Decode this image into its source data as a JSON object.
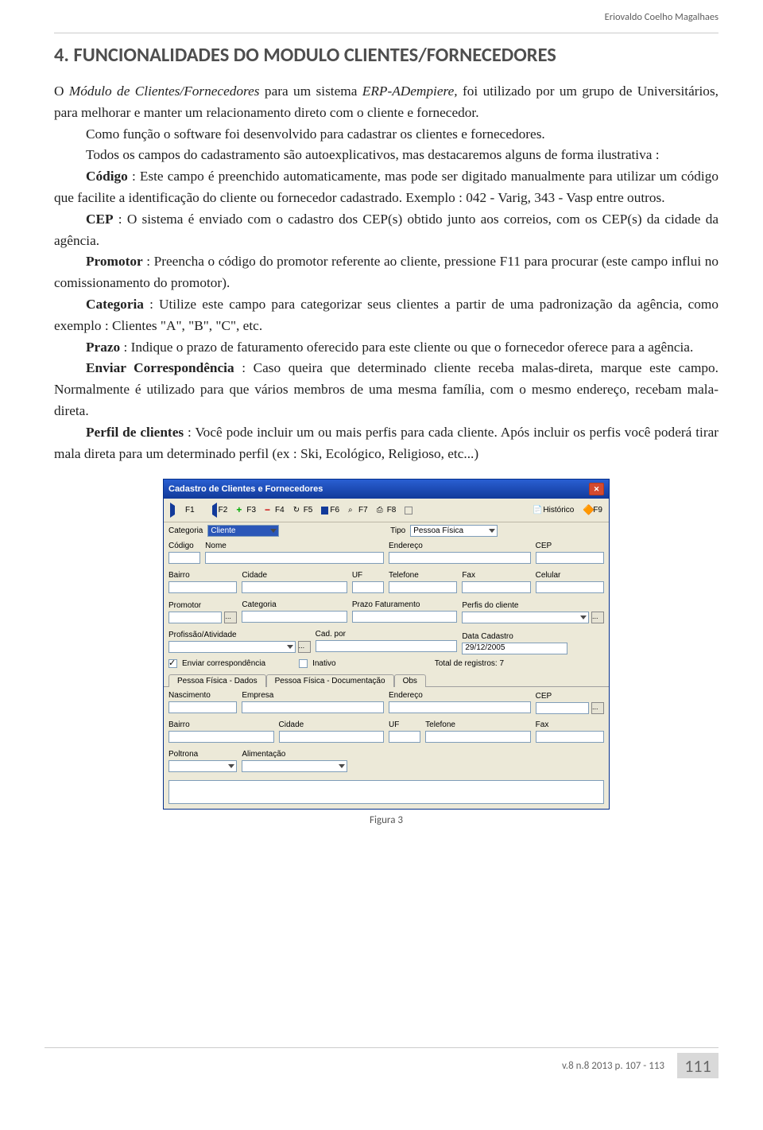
{
  "header_author": "Eriovaldo Coelho Magalhaes",
  "title": "4.   FUNCIONALIDADES DO MODULO CLIENTES/FORNECEDORES",
  "body": {
    "p1a": "O ",
    "p1b": "Módulo de Clientes/Fornecedores",
    "p1c": " para um sistema  ",
    "p1d": "ERP-ADempiere,",
    "p1e": " foi utilizado por um grupo de Universitários, para melhorar e manter um relacionamento direto com o cliente e fornecedor.",
    "p2": "Como função o software foi desenvolvido para cadastrar os clientes e fornecedores.",
    "p3": "Todos os campos do cadastramento são autoexplicativos, mas destacaremos alguns de forma ilustrativa :",
    "p4a": "Código",
    "p4b": " : Este campo é preenchido automaticamente, mas pode ser digitado manualmente para utilizar um código que facilite a identificação do cliente ou fornecedor cadastrado. Exemplo : 042 - Varig, 343 - Vasp entre outros.",
    "p5a": "CEP",
    "p5b": " : O sistema é enviado com o cadastro dos CEP(s) obtido junto aos correios, com os CEP(s) da cidade da agência.",
    "p6a": "Promotor",
    "p6b": " : Preencha o código do promotor referente ao cliente, pressione F11 para procurar (este campo influi no comissionamento do promotor).",
    "p7a": "Categoria",
    "p7b": " : Utilize este campo para categorizar seus clientes a partir de uma padronização da agência, como exemplo : Clientes \"A\", \"B\", \"C\", etc.",
    "p8a": "Prazo",
    "p8b": " : Indique o prazo de faturamento oferecido para este cliente ou que o fornecedor oferece para a agência.",
    "p9a": "Enviar Correspondência",
    "p9b": " : Caso  queira que determinado cliente receba malas-direta, marque este campo. Normalmente é utilizado para que vários membros de uma mesma família, com o mesmo endereço, recebam mala-direta.",
    "p10a": "Perfil de clientes",
    "p10b": " : Você pode incluir um ou mais perfis para cada cliente. Após incluir os perfis você poderá tirar mala direta para um determinado perfil (ex : Ski, Ecológico, Religioso, etc...)"
  },
  "figure_caption": "Figura 3",
  "form": {
    "title": "Cadastro de Clientes e Fornecedores",
    "toolbar": {
      "f1": "F1",
      "f2": "F2",
      "f3": "F3",
      "f4": "F4",
      "f5": "F5",
      "f6": "F6",
      "f7": "F7",
      "f8": "F8",
      "hist": "Histórico",
      "f9": "F9"
    },
    "row1": {
      "categoria_lbl": "Categoria",
      "categoria_val": "Cliente",
      "tipo_lbl": "Tipo",
      "tipo_val": "Pessoa Física"
    },
    "labels": {
      "codigo": "Código",
      "nome": "Nome",
      "endereco": "Endereço",
      "cep": "CEP",
      "bairro": "Bairro",
      "cidade": "Cidade",
      "uf": "UF",
      "telefone": "Telefone",
      "fax": "Fax",
      "celular": "Celular",
      "promotor": "Promotor",
      "categoria2": "Categoria",
      "prazo": "Prazo Faturamento",
      "perfis": "Perfis do cliente",
      "profissao": "Profissão/Atividade",
      "cad_por": "Cad. por",
      "data_cad": "Data Cadastro",
      "data_cad_val": "29/12/2005",
      "enviar": "Enviar correspondência",
      "inativo": "Inativo",
      "total_reg": "Total de registros:   7",
      "tabs": [
        "Pessoa Física - Dados",
        "Pessoa Física - Documentação",
        "Obs"
      ],
      "nascimento": "Nascimento",
      "empresa": "Empresa",
      "poltrona": "Poltrona",
      "aliment": "Alimentação"
    }
  },
  "footer": {
    "issue": "v.8 n.8 2013 p. 107 - 113",
    "page": "111"
  }
}
